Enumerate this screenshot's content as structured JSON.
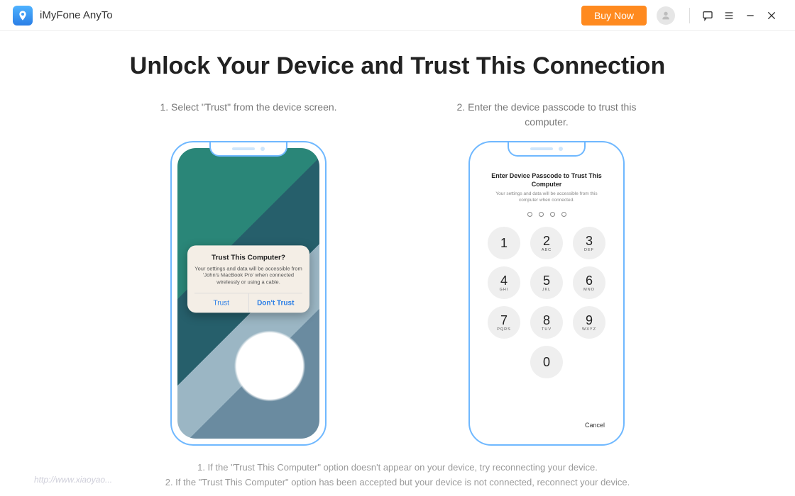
{
  "titlebar": {
    "app_name": "iMyFone AnyTo",
    "buy_label": "Buy Now"
  },
  "page": {
    "title": "Unlock Your Device and Trust This Connection"
  },
  "step1": {
    "caption": "1. Select \"Trust\" from the device screen.",
    "dialog_title": "Trust This Computer?",
    "dialog_body": "Your settings and data will be accessible from 'John's MacBook Pro' when connected wirelessly or using a cable.",
    "trust": "Trust",
    "dont_trust": "Don't Trust"
  },
  "step2": {
    "caption": "2. Enter the device passcode to trust this computer.",
    "pass_title": "Enter Device Passcode to Trust This Computer",
    "pass_sub": "Your settings and data will be accessible from this computer when connected.",
    "cancel": "Cancel",
    "keys": {
      "k1": {
        "n": "1",
        "l": ""
      },
      "k2": {
        "n": "2",
        "l": "ABC"
      },
      "k3": {
        "n": "3",
        "l": "DEF"
      },
      "k4": {
        "n": "4",
        "l": "GHI"
      },
      "k5": {
        "n": "5",
        "l": "JKL"
      },
      "k6": {
        "n": "6",
        "l": "MNO"
      },
      "k7": {
        "n": "7",
        "l": "PQRS"
      },
      "k8": {
        "n": "8",
        "l": "TUV"
      },
      "k9": {
        "n": "9",
        "l": "WXYZ"
      },
      "k0": {
        "n": "0",
        "l": ""
      }
    }
  },
  "notes": {
    "line1": "1. If the \"Trust This Computer\" option doesn't appear on your device, try reconnecting your device.",
    "line2": "2. If the \"Trust This Computer\" option has been accepted but your device is not connected, reconnect your device."
  },
  "watermark": "http://www.xiaoyao..."
}
